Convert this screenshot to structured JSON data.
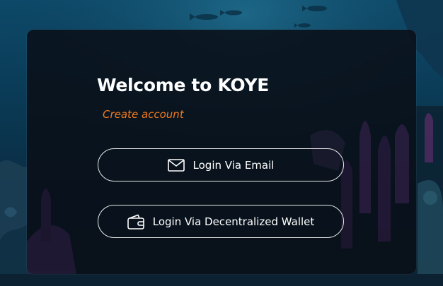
{
  "colors": {
    "panel_bg": "#090e16",
    "accent_link": "#f07a1f",
    "text": "#ffffff",
    "button_border": "#e8e8e8"
  },
  "login": {
    "title": "Welcome to KOYE",
    "create_account_link": "Create account",
    "email_button": {
      "label": "Login Via Email",
      "icon": "envelope-icon"
    },
    "wallet_button": {
      "label": "Login Via Decentralized Wallet",
      "icon": "wallet-icon"
    }
  }
}
